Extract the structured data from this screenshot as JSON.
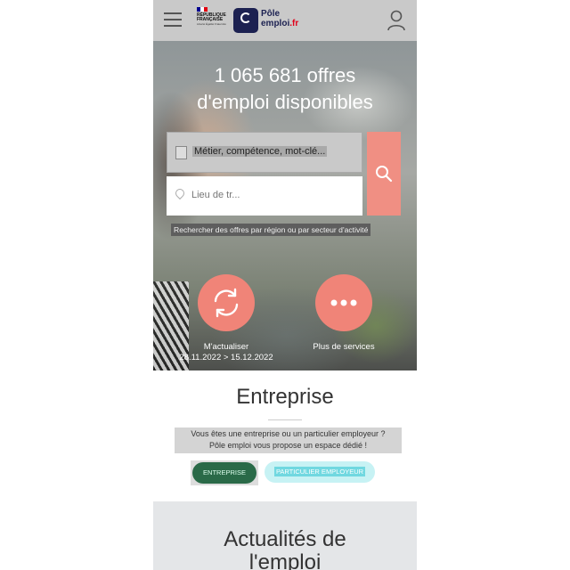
{
  "header": {
    "menu_icon": "hamburger-menu-icon",
    "rf_logo_text": "RÉPUBLIQUE FRANÇAISE",
    "rf_motto": "Liberté Égalité Fraternité",
    "brand_line1": "Pôle",
    "brand_line2_a": "emploi",
    "brand_line2_b": ".fr",
    "user_icon": "user-account-icon"
  },
  "hero": {
    "title_line1": "1 065 681 offres",
    "title_line2": "d'emploi disponibles",
    "search_placeholder": "Métier, compétence, mot-clé...",
    "place_placeholder": "Lieu de tr...",
    "search_icon": "search-icon",
    "region_link": "Rechercher des offres par région ou par secteur d'activité",
    "actions": [
      {
        "label": "M'actualiser",
        "sub": "28.11.2022 > 15.12.2022",
        "icon": "refresh-icon"
      },
      {
        "label": "Plus de services",
        "sub": "",
        "icon": "more-dots-icon"
      }
    ]
  },
  "entreprise": {
    "title": "Entreprise",
    "desc_line1": "Vous êtes une entreprise ou un particulier employeur ?",
    "desc_line2": "Pôle emploi vous propose un espace dédié !",
    "btn_entreprise": "ENTREPRISE",
    "btn_particulier": "PARTICULIER EMPLOYEUR"
  },
  "news": {
    "title_line1": "Actualités de",
    "title_line2": "l'emploi"
  },
  "colors": {
    "accent": "#f08478",
    "brand_navy": "#1c2151",
    "enterprise_green": "#2a6a48"
  }
}
